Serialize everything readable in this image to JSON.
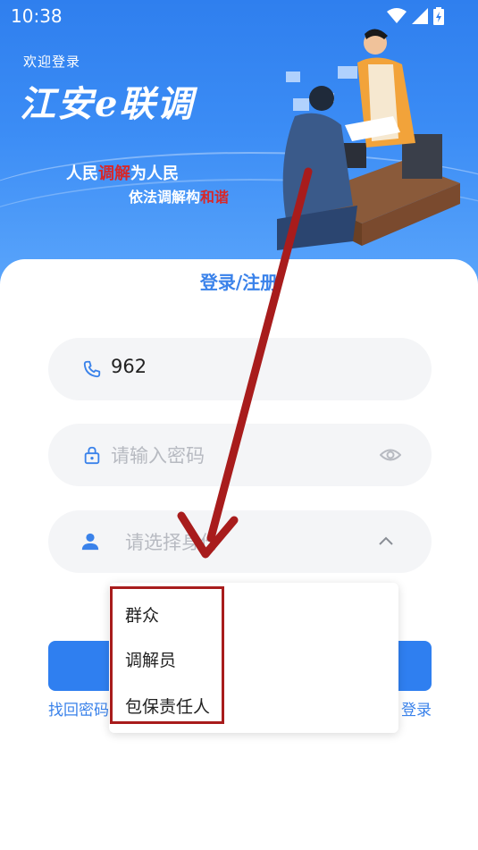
{
  "status_bar": {
    "time": "10:38"
  },
  "banner": {
    "welcome": "欢迎登录",
    "app_title": "江安e联调",
    "slogan_line1": {
      "pre": "人民",
      "red": "调解",
      "post": "为人民"
    },
    "slogan_line2": {
      "pre": "依法调解构",
      "red": "和谐"
    }
  },
  "card": {
    "title": "登录/注册"
  },
  "form": {
    "phone_value": "962",
    "password_placeholder": "请输入密码",
    "role_placeholder": "请选择身份"
  },
  "dropdown": {
    "options": [
      "群众",
      "调解员",
      "包保责任人"
    ]
  },
  "links": {
    "left": "找回密码",
    "right": "登录"
  },
  "colors": {
    "accent": "#3a82ea",
    "annotation": "#a81c1c"
  },
  "icons": [
    "wifi-icon",
    "signal-icon",
    "battery-icon",
    "phone-icon",
    "lock-icon",
    "eye-icon",
    "user-icon",
    "chevron-up-icon"
  ]
}
